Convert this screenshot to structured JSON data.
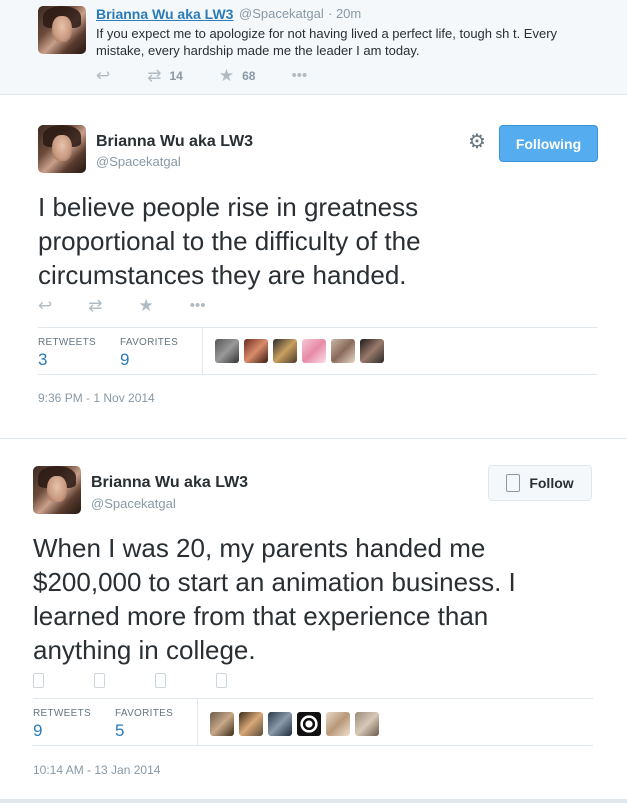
{
  "compact_tweet": {
    "name": "Brianna Wu aka LW3",
    "handle": "@Spacekatgal",
    "time": "· 20m",
    "text": "If you expect me to apologize for not having lived a perfect life, tough sh t. Every mistake, every hardship made me the leader I am today.",
    "retweet_count": "14",
    "favorite_count": "68"
  },
  "tweet1": {
    "name": "Brianna Wu aka LW3",
    "handle": "@Spacekatgal",
    "button_label": "Following",
    "text": "I believe people rise in greatness proportional to the difficulty of the circumstances they are handed.",
    "retweets_label": "RETWEETS",
    "retweets_value": "3",
    "favorites_label": "FAVORITES",
    "favorites_value": "9",
    "timestamp": "9:36 PM - 1 Nov 2014"
  },
  "tweet2": {
    "name": "Brianna Wu aka LW3",
    "handle": "@Spacekatgal",
    "button_label": "Follow",
    "text": "When I was 20, my parents handed me $200,000 to start an animation business. I learned more from that experience than anything in college.",
    "retweets_label": "RETWEETS",
    "retweets_value": "9",
    "favorites_label": "FAVORITES",
    "favorites_value": "5",
    "timestamp": "10:14 AM - 13 Jan 2014"
  },
  "icons": {
    "reply": "reply-icon",
    "retweet": "retweet-icon",
    "favorite": "star-icon",
    "more": "more-icon",
    "settings": "gear-icon"
  },
  "colors": {
    "link_blue": "#2b7bb9",
    "button_blue": "#55acee",
    "muted": "#8899a6",
    "text": "#292f33"
  }
}
